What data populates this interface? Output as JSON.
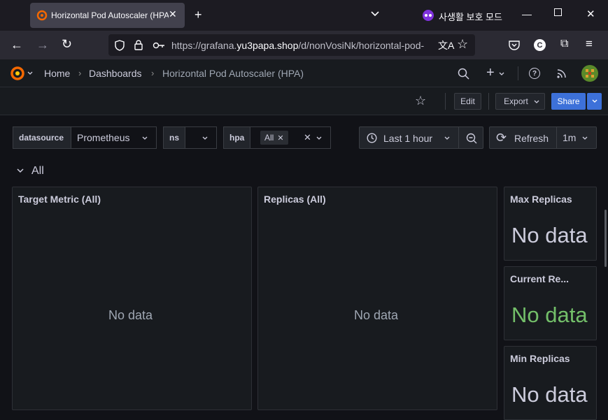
{
  "browser": {
    "tab_title": "Horizontal Pod Autoscaler (HPA)",
    "private_label": "사생활 보호 모드",
    "url_prefix": "https://grafana.",
    "url_domain": "yu3papa.shop",
    "url_path": "/d/nonVosiNk/horizontal-pod-"
  },
  "breadcrumb": {
    "home": "Home",
    "dashboards": "Dashboards",
    "current": "Horizontal Pod Autoscaler (HPA)"
  },
  "toolbar": {
    "edit": "Edit",
    "export": "Export",
    "share": "Share"
  },
  "variables": {
    "datasource_label": "datasource",
    "datasource_value": "Prometheus",
    "ns_label": "ns",
    "hpa_label": "hpa",
    "hpa_value": "All"
  },
  "time": {
    "range": "Last 1 hour",
    "refresh": "Refresh",
    "interval": "1m"
  },
  "row": {
    "title": "All"
  },
  "panels": {
    "target_metric": {
      "title": "Target Metric (All)",
      "body": "No data"
    },
    "replicas": {
      "title": "Replicas (All)",
      "body": "No data"
    },
    "max_replicas": {
      "title": "Max Replicas",
      "body": "No data"
    },
    "current_replicas": {
      "title": "Current Re...",
      "body": "No data"
    },
    "min_replicas": {
      "title": "Min Replicas",
      "body": "No data"
    }
  },
  "colors": {
    "current_replicas_value": "#73bf69",
    "share_button": "#3d71d9"
  },
  "icons": [
    "grafana-favicon",
    "close-icon",
    "new-tab-icon",
    "tab-list-icon",
    "private-mask-icon",
    "minimize-icon",
    "maximize-icon",
    "window-close-icon",
    "back-icon",
    "forward-icon",
    "reload-icon",
    "shield-icon",
    "lock-icon",
    "key-icon",
    "translate-icon",
    "star-icon",
    "pocket-icon",
    "account-icon",
    "extensions-icon",
    "menu-icon",
    "grafana-logo",
    "search-icon",
    "plus-icon",
    "help-icon",
    "rss-icon",
    "avatar",
    "clock-icon",
    "zoom-out-icon",
    "refresh-icon",
    "chevron-down-icon"
  ]
}
